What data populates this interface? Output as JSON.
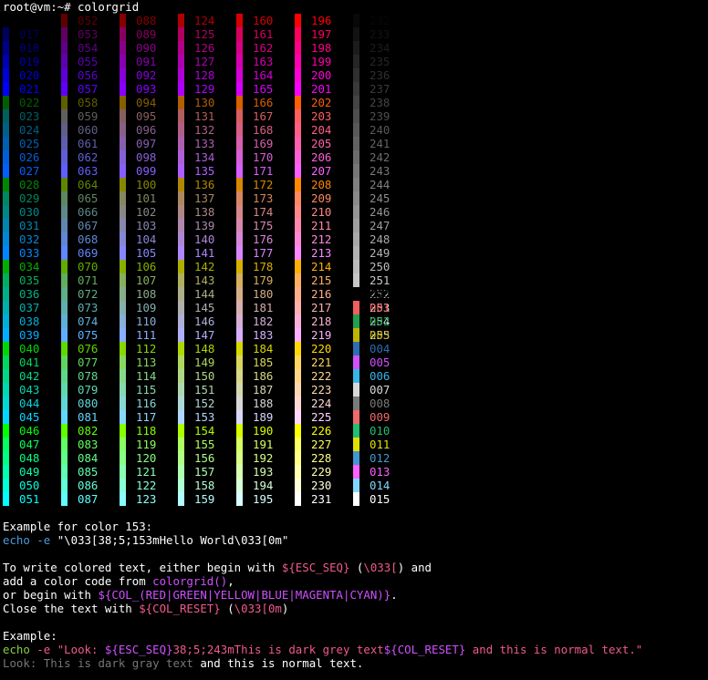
{
  "terminal": {
    "prompt": "root@vm:~# colorgrid"
  },
  "colors": {
    "base16": [
      "#000000",
      "#f0605c",
      "#20a050",
      "#c0b400",
      "#2b6fb0",
      "#d050ff",
      "#36b6e6",
      "#d8d8d8",
      "#7a7a7a",
      "#f06a6a",
      "#20c070",
      "#e0e000",
      "#4098d0",
      "#ff60ff",
      "#80d8ff",
      "#ffffff"
    ],
    "code_blue": "#4c9ad8",
    "code_pink": "#f05a8c",
    "code_green": "#8acc3e",
    "code_dark_grey": "#767676"
  },
  "help": {
    "example_heading": "Example for color 153:",
    "example_cmd_echo": "echo -e",
    "example_cmd_string": "\"\\033[38;5;153mHello World\\033[0m\"",
    "line1_a": "To write colored text, either begin with ",
    "line1_b": "${ESC_SEQ}",
    "line1_c": " (",
    "line1_d": "\\033[",
    "line1_e": ") and",
    "line2_a": "add a color code from ",
    "line2_b": "colorgrid()",
    "line2_c": ",",
    "line3_a": "or begin with ",
    "line3_b": "${COL_(RED|GREEN|YELLOW|BLUE|MAGENTA|CYAN)}",
    "line3_c": ".",
    "line4_a": "Close the text with ",
    "line4_b": "${COL_RESET}",
    "line4_c": " (",
    "line4_d": "\\033[0m",
    "line4_e": ")",
    "example2_heading": "Example:",
    "ex2_echo": "echo",
    "ex2_flag": " -e ",
    "ex2_q1": "\"Look: ",
    "ex2_var1": "${ESC_SEQ}",
    "ex2_code": "38;5;243m",
    "ex2_text1": "This is dark grey text",
    "ex2_var2": "${COL_RESET}",
    "ex2_text2": " and this is normal text.\"",
    "out_look": "Look: ",
    "out_grey": "This is dark gray text",
    "out_rest": " and this is normal text."
  }
}
